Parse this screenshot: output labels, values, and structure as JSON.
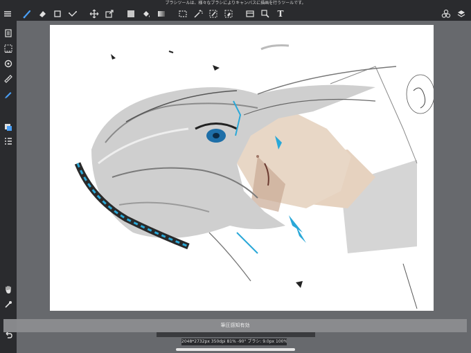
{
  "app": {
    "tooltip": "ブラシツールは、様々なブラシによりキャンバスに描画を行うツールです。",
    "toast": "筆圧感知有効",
    "status": "2048*2732px 350dpi 81% -90° ブラシ: 9.0px 100%"
  },
  "toolbar": {
    "menu_icon": "menu-icon",
    "tools": [
      "brush-tool",
      "eraser-tool",
      "shape-tool",
      "fill-line-tool",
      "move-tool",
      "transform-tool",
      "fill-color-tool",
      "bucket-tool",
      "gradient-tool",
      "select-tool",
      "magic-wand-tool",
      "select-pen-tool",
      "select-eraser-tool",
      "layer-tool",
      "reference-tool",
      "text-tool",
      "materials-tool",
      "layers-tool"
    ],
    "text_tool_label": "T"
  },
  "sidebar": {
    "tools": [
      "pages-icon",
      "selection-icon",
      "rotate-icon",
      "ruler-icon",
      "pen-icon",
      "color-icon",
      "layers-list-icon",
      "hand-icon",
      "eyedropper-icon",
      "undo-icon"
    ]
  },
  "canvas": {
    "background": "#ffffff",
    "accent_cyan": "#2aa8d8"
  },
  "colors": {
    "bar": "#2a2b2e",
    "workspace": "#67696d",
    "active_tool": "#4a9ff5"
  }
}
